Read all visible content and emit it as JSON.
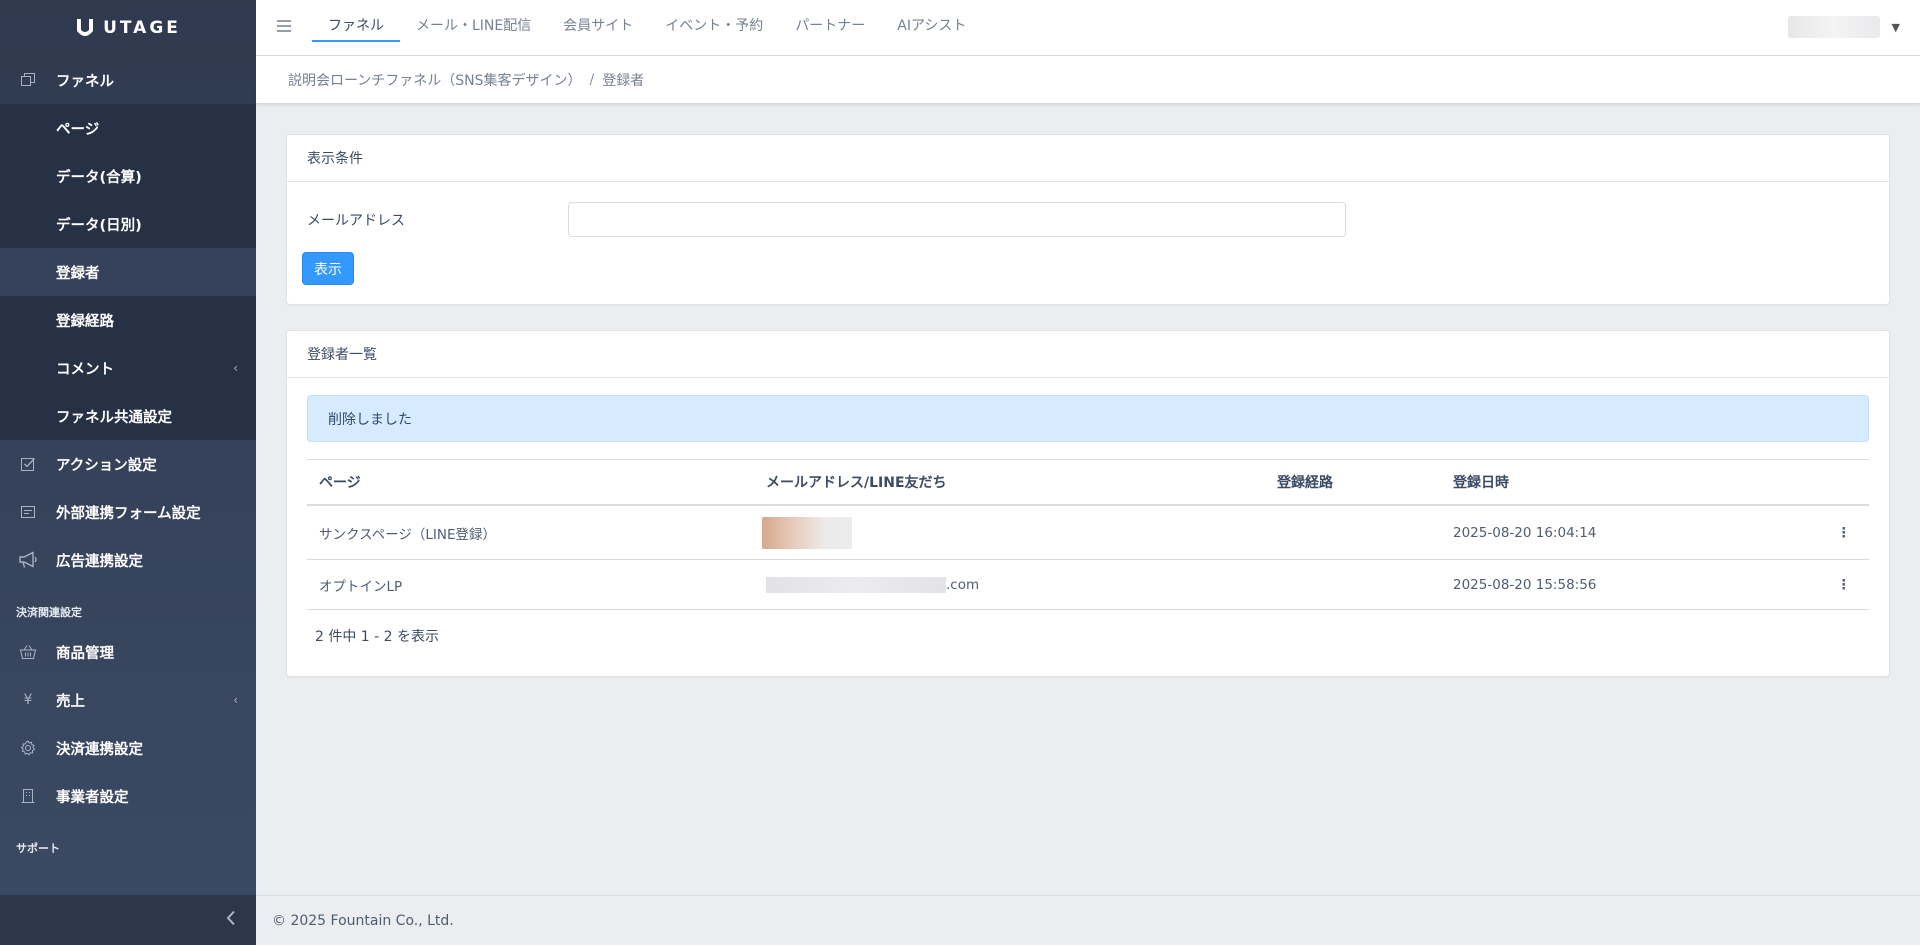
{
  "brand": {
    "name": "UTAGE"
  },
  "sidebar": {
    "items": [
      {
        "label": "ファネル",
        "icon": "copy-icon"
      },
      {
        "label": "ページ"
      },
      {
        "label": "データ(合算)"
      },
      {
        "label": "データ(日別)"
      },
      {
        "label": "登録者"
      },
      {
        "label": "登録経路"
      },
      {
        "label": "コメント"
      },
      {
        "label": "ファネル共通設定"
      },
      {
        "label": "アクション設定",
        "icon": "check-square-icon"
      },
      {
        "label": "外部連携フォーム設定",
        "icon": "form-icon"
      },
      {
        "label": "広告連携設定",
        "icon": "megaphone-icon"
      }
    ],
    "section_payment": "決済関連設定",
    "payment_items": [
      {
        "label": "商品管理",
        "icon": "basket-icon"
      },
      {
        "label": "売上",
        "icon": "yen-icon"
      },
      {
        "label": "決済連携設定",
        "icon": "gear-icon"
      },
      {
        "label": "事業者設定",
        "icon": "building-icon"
      }
    ],
    "section_support": "サポート"
  },
  "header": {
    "tabs": [
      "ファネル",
      "メール・LINE配信",
      "会員サイト",
      "イベント・予約",
      "パートナー",
      "AIアシスト"
    ]
  },
  "breadcrumb": {
    "parent": "説明会ローンチファネル（SNS集客デザイン）",
    "separator": "/",
    "current": "登録者"
  },
  "filter": {
    "title": "表示条件",
    "email_label": "メールアドレス",
    "email_value": "",
    "submit_label": "表示"
  },
  "list": {
    "title": "登録者一覧",
    "alert": "削除しました",
    "columns": [
      "ページ",
      "メールアドレス/LINE友だち",
      "登録経路",
      "登録日時"
    ],
    "rows": [
      {
        "page": "サンクスページ（LINE登録）",
        "email": "",
        "route": "",
        "datetime": "2025-08-20 16:04:14"
      },
      {
        "page": "オプトインLP",
        "email": ".com",
        "route": "",
        "datetime": "2025-08-20 15:58:56"
      }
    ],
    "pager_info": "2 件中 1 - 2 を表示"
  },
  "footer": {
    "copyright": "© 2025 Fountain Co., Ltd."
  },
  "colors": {
    "primary": "#3399ff",
    "sidebar": "#2f3a4f",
    "alert_bg": "#d6ebff"
  }
}
